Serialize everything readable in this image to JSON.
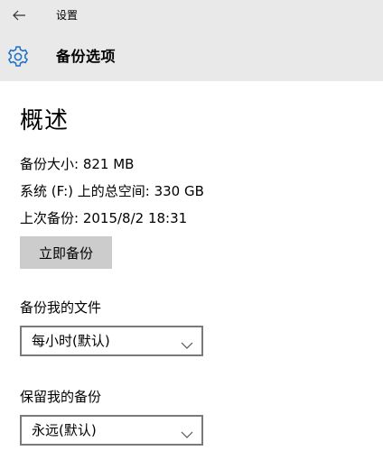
{
  "window": {
    "title": "设置",
    "back_icon": "arrow-left-icon"
  },
  "header": {
    "icon": "gear-icon",
    "accent_color": "#1e6fc2",
    "title": "备份选项"
  },
  "overview": {
    "title": "概述",
    "backup_size": "备份大小: 821 MB",
    "total_space": "系统 (F:) 上的总空间: 330 GB",
    "last_backup": "上次备份: 2015/8/2 18:31",
    "backup_now_label": "立即备份"
  },
  "backup_files": {
    "label": "备份我的文件",
    "selected": "每小时(默认)"
  },
  "keep_backups": {
    "label": "保留我的备份",
    "selected": "永远(默认)"
  }
}
